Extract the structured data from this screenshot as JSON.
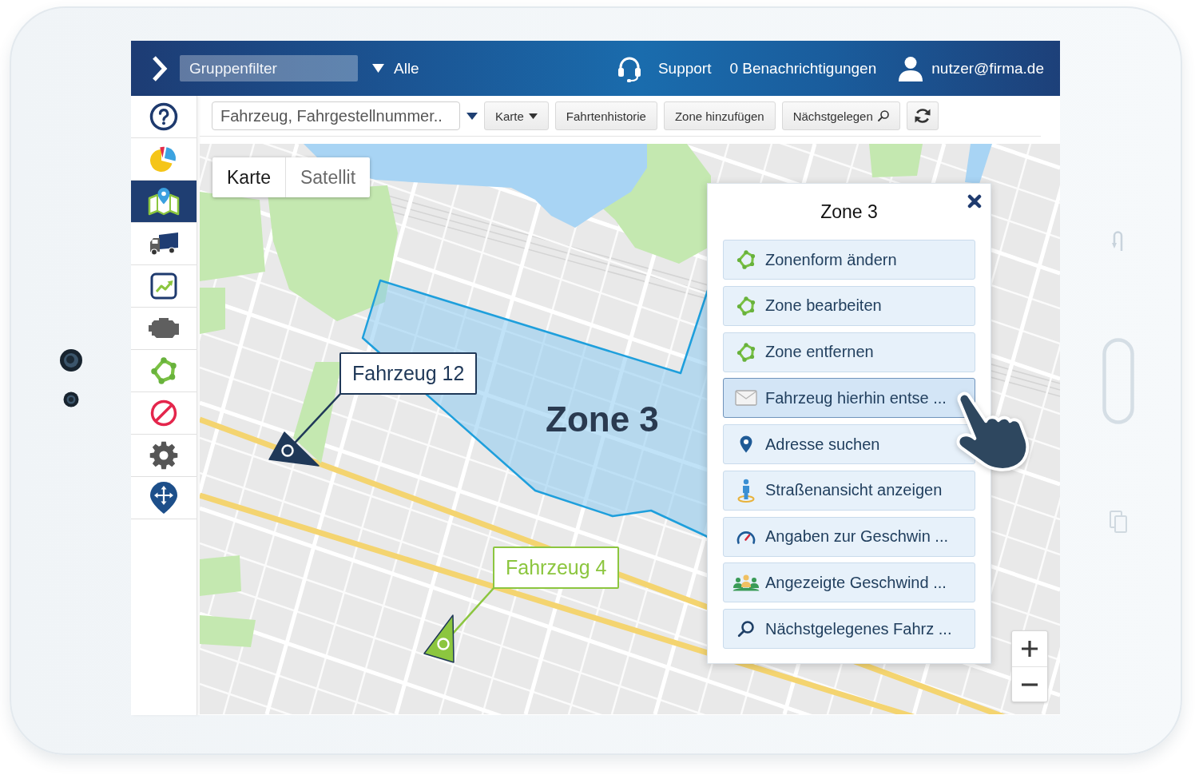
{
  "top_bar": {
    "group_filter": {
      "placeholder": "Gruppenfilter"
    },
    "filter_select": {
      "value": "Alle"
    },
    "support": "Support",
    "notifications": "0 Benachrichtigungen",
    "user": "nutzer@firma.de"
  },
  "sidebar": {
    "items": [
      {
        "kind": "help",
        "selected": false
      },
      {
        "kind": "pie",
        "selected": false
      },
      {
        "kind": "map",
        "selected": true
      },
      {
        "kind": "truck",
        "selected": false
      },
      {
        "kind": "chart",
        "selected": false
      },
      {
        "kind": "engine",
        "selected": false
      },
      {
        "kind": "zone",
        "selected": false
      },
      {
        "kind": "block",
        "selected": false
      },
      {
        "kind": "gear",
        "selected": false
      },
      {
        "kind": "pin",
        "selected": false
      }
    ]
  },
  "toolbar": {
    "search": {
      "placeholder": "Fahrzeug, Fahrgestellnummer.."
    },
    "buttons": [
      {
        "kind": "dropdown",
        "label": "Karte"
      },
      {
        "kind": "plain",
        "label": "Fahrtenhistorie"
      },
      {
        "kind": "plain",
        "label": "Zone hinzufügen"
      },
      {
        "kind": "search",
        "label": "Nächstgelegen"
      },
      {
        "kind": "refresh"
      }
    ]
  },
  "map": {
    "map_type": [
      {
        "label": "Karte",
        "selected": true
      },
      {
        "label": "Satellit",
        "selected": false
      }
    ],
    "zone": {
      "label": "Zone 3"
    },
    "vehicles": [
      {
        "label": "Fahrzeug 12",
        "color": "#1f3858"
      },
      {
        "label": "Fahrzeug 4",
        "color": "#8cc63f"
      }
    ]
  },
  "zone_menu": {
    "title": "Zone 3",
    "items": [
      {
        "kind": "zone",
        "label": "Zonenform ändern",
        "selected": false
      },
      {
        "kind": "zone",
        "label": "Zone bearbeiten",
        "selected": false
      },
      {
        "kind": "zone",
        "label": "Zone entfernen",
        "selected": false
      },
      {
        "kind": "mail",
        "label": "Fahrzeug hierhin entse ...",
        "selected": true
      },
      {
        "kind": "pin",
        "label": "Adresse suchen",
        "selected": false
      },
      {
        "kind": "person",
        "label": "Straßenansicht anzeigen",
        "selected": false
      },
      {
        "kind": "speed",
        "label": "Angaben zur Geschwin ...",
        "selected": false
      },
      {
        "kind": "group",
        "label": "Angezeigte Geschwind ...",
        "selected": false
      },
      {
        "kind": "search",
        "label": "Nächstgelegenes Fahrz ...",
        "selected": false
      }
    ]
  }
}
